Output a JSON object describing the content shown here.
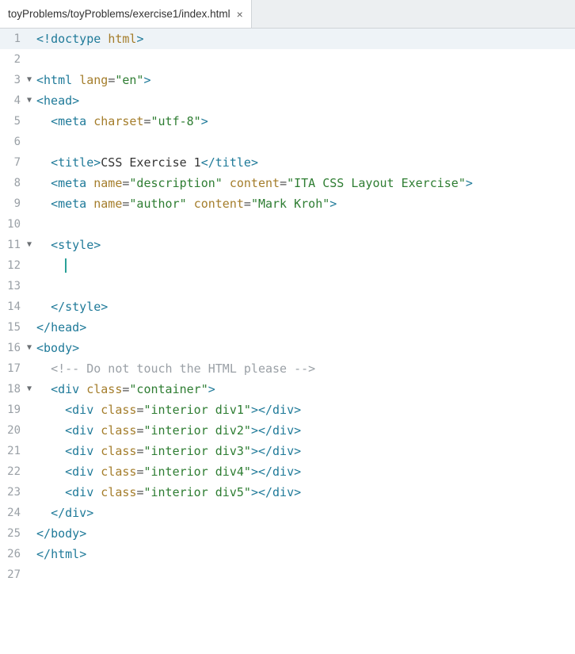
{
  "tab": {
    "title": "toyProblems/toyProblems/exercise1/index.html",
    "close": "×"
  },
  "fold_glyph": "▼",
  "lines": [
    {
      "n": "1",
      "fold": "",
      "active": true,
      "tokens": [
        {
          "c": "t-punc",
          "t": "<!"
        },
        {
          "c": "t-doctype",
          "t": "doctype "
        },
        {
          "c": "t-attr2",
          "t": "html"
        },
        {
          "c": "t-punc",
          "t": ">"
        }
      ]
    },
    {
      "n": "2",
      "fold": "",
      "tokens": []
    },
    {
      "n": "3",
      "fold": "▼",
      "tokens": [
        {
          "c": "t-punc",
          "t": "<"
        },
        {
          "c": "t-tag",
          "t": "html "
        },
        {
          "c": "t-attr2",
          "t": "lang"
        },
        {
          "c": "t-eq",
          "t": "="
        },
        {
          "c": "t-val",
          "t": "\"en\""
        },
        {
          "c": "t-punc",
          "t": ">"
        }
      ]
    },
    {
      "n": "4",
      "fold": "▼",
      "tokens": [
        {
          "c": "t-punc",
          "t": "<"
        },
        {
          "c": "t-tag",
          "t": "head"
        },
        {
          "c": "t-punc",
          "t": ">"
        }
      ]
    },
    {
      "n": "5",
      "fold": "",
      "indent": "  ",
      "tokens": [
        {
          "c": "t-punc",
          "t": "<"
        },
        {
          "c": "t-tag",
          "t": "meta "
        },
        {
          "c": "t-attr2",
          "t": "charset"
        },
        {
          "c": "t-eq",
          "t": "="
        },
        {
          "c": "t-val",
          "t": "\"utf-8\""
        },
        {
          "c": "t-punc",
          "t": ">"
        }
      ]
    },
    {
      "n": "6",
      "fold": "",
      "tokens": []
    },
    {
      "n": "7",
      "fold": "",
      "indent": "  ",
      "tokens": [
        {
          "c": "t-punc",
          "t": "<"
        },
        {
          "c": "t-tag",
          "t": "title"
        },
        {
          "c": "t-punc",
          "t": ">"
        },
        {
          "c": "t-text",
          "t": "CSS Exercise 1"
        },
        {
          "c": "t-punc",
          "t": "</"
        },
        {
          "c": "t-tag",
          "t": "title"
        },
        {
          "c": "t-punc",
          "t": ">"
        }
      ]
    },
    {
      "n": "8",
      "fold": "",
      "indent": "  ",
      "tokens": [
        {
          "c": "t-punc",
          "t": "<"
        },
        {
          "c": "t-tag",
          "t": "meta "
        },
        {
          "c": "t-attr2",
          "t": "name"
        },
        {
          "c": "t-eq",
          "t": "="
        },
        {
          "c": "t-val",
          "t": "\"description\""
        },
        {
          "c": "t-text",
          "t": " "
        },
        {
          "c": "t-attr2",
          "t": "content"
        },
        {
          "c": "t-eq",
          "t": "="
        },
        {
          "c": "t-val",
          "t": "\"ITA CSS Layout Exercise\""
        },
        {
          "c": "t-punc",
          "t": ">"
        }
      ]
    },
    {
      "n": "9",
      "fold": "",
      "indent": "  ",
      "tokens": [
        {
          "c": "t-punc",
          "t": "<"
        },
        {
          "c": "t-tag",
          "t": "meta "
        },
        {
          "c": "t-attr2",
          "t": "name"
        },
        {
          "c": "t-eq",
          "t": "="
        },
        {
          "c": "t-val",
          "t": "\"author\""
        },
        {
          "c": "t-text",
          "t": " "
        },
        {
          "c": "t-attr2",
          "t": "content"
        },
        {
          "c": "t-eq",
          "t": "="
        },
        {
          "c": "t-val",
          "t": "\"Mark Kroh\""
        },
        {
          "c": "t-punc",
          "t": ">"
        }
      ]
    },
    {
      "n": "10",
      "fold": "",
      "tokens": []
    },
    {
      "n": "11",
      "fold": "▼",
      "indent": "  ",
      "tokens": [
        {
          "c": "t-punc",
          "t": "<"
        },
        {
          "c": "t-tag",
          "t": "style"
        },
        {
          "c": "t-punc",
          "t": ">"
        }
      ]
    },
    {
      "n": "12",
      "fold": "",
      "indent": "    ",
      "cursor": true,
      "tokens": []
    },
    {
      "n": "13",
      "fold": "",
      "tokens": []
    },
    {
      "n": "14",
      "fold": "",
      "indent": "  ",
      "tokens": [
        {
          "c": "t-punc",
          "t": "</"
        },
        {
          "c": "t-tag",
          "t": "style"
        },
        {
          "c": "t-punc",
          "t": ">"
        }
      ]
    },
    {
      "n": "15",
      "fold": "",
      "tokens": [
        {
          "c": "t-punc",
          "t": "</"
        },
        {
          "c": "t-tag",
          "t": "head"
        },
        {
          "c": "t-punc",
          "t": ">"
        }
      ]
    },
    {
      "n": "16",
      "fold": "▼",
      "tokens": [
        {
          "c": "t-punc",
          "t": "<"
        },
        {
          "c": "t-tag",
          "t": "body"
        },
        {
          "c": "t-punc",
          "t": ">"
        }
      ]
    },
    {
      "n": "17",
      "fold": "",
      "indent": "  ",
      "tokens": [
        {
          "c": "t-comment",
          "t": "<!-- Do not touch the HTML please -->"
        }
      ]
    },
    {
      "n": "18",
      "fold": "▼",
      "indent": "  ",
      "tokens": [
        {
          "c": "t-punc",
          "t": "<"
        },
        {
          "c": "t-tag",
          "t": "div "
        },
        {
          "c": "t-attr2",
          "t": "class"
        },
        {
          "c": "t-eq",
          "t": "="
        },
        {
          "c": "t-val",
          "t": "\"container\""
        },
        {
          "c": "t-punc",
          "t": ">"
        }
      ]
    },
    {
      "n": "19",
      "fold": "",
      "indent": "    ",
      "tokens": [
        {
          "c": "t-punc",
          "t": "<"
        },
        {
          "c": "t-tag",
          "t": "div "
        },
        {
          "c": "t-attr2",
          "t": "class"
        },
        {
          "c": "t-eq",
          "t": "="
        },
        {
          "c": "t-val",
          "t": "\"interior div1\""
        },
        {
          "c": "t-punc",
          "t": "></"
        },
        {
          "c": "t-tag",
          "t": "div"
        },
        {
          "c": "t-punc",
          "t": ">"
        }
      ]
    },
    {
      "n": "20",
      "fold": "",
      "indent": "    ",
      "tokens": [
        {
          "c": "t-punc",
          "t": "<"
        },
        {
          "c": "t-tag",
          "t": "div "
        },
        {
          "c": "t-attr2",
          "t": "class"
        },
        {
          "c": "t-eq",
          "t": "="
        },
        {
          "c": "t-val",
          "t": "\"interior div2\""
        },
        {
          "c": "t-punc",
          "t": "></"
        },
        {
          "c": "t-tag",
          "t": "div"
        },
        {
          "c": "t-punc",
          "t": ">"
        }
      ]
    },
    {
      "n": "21",
      "fold": "",
      "indent": "    ",
      "tokens": [
        {
          "c": "t-punc",
          "t": "<"
        },
        {
          "c": "t-tag",
          "t": "div "
        },
        {
          "c": "t-attr2",
          "t": "class"
        },
        {
          "c": "t-eq",
          "t": "="
        },
        {
          "c": "t-val",
          "t": "\"interior div3\""
        },
        {
          "c": "t-punc",
          "t": "></"
        },
        {
          "c": "t-tag",
          "t": "div"
        },
        {
          "c": "t-punc",
          "t": ">"
        }
      ]
    },
    {
      "n": "22",
      "fold": "",
      "indent": "    ",
      "tokens": [
        {
          "c": "t-punc",
          "t": "<"
        },
        {
          "c": "t-tag",
          "t": "div "
        },
        {
          "c": "t-attr2",
          "t": "class"
        },
        {
          "c": "t-eq",
          "t": "="
        },
        {
          "c": "t-val",
          "t": "\"interior div4\""
        },
        {
          "c": "t-punc",
          "t": "></"
        },
        {
          "c": "t-tag",
          "t": "div"
        },
        {
          "c": "t-punc",
          "t": ">"
        }
      ]
    },
    {
      "n": "23",
      "fold": "",
      "indent": "    ",
      "tokens": [
        {
          "c": "t-punc",
          "t": "<"
        },
        {
          "c": "t-tag",
          "t": "div "
        },
        {
          "c": "t-attr2",
          "t": "class"
        },
        {
          "c": "t-eq",
          "t": "="
        },
        {
          "c": "t-val",
          "t": "\"interior div5\""
        },
        {
          "c": "t-punc",
          "t": "></"
        },
        {
          "c": "t-tag",
          "t": "div"
        },
        {
          "c": "t-punc",
          "t": ">"
        }
      ]
    },
    {
      "n": "24",
      "fold": "",
      "indent": "  ",
      "tokens": [
        {
          "c": "t-punc",
          "t": "</"
        },
        {
          "c": "t-tag",
          "t": "div"
        },
        {
          "c": "t-punc",
          "t": ">"
        }
      ]
    },
    {
      "n": "25",
      "fold": "",
      "tokens": [
        {
          "c": "t-punc",
          "t": "</"
        },
        {
          "c": "t-tag",
          "t": "body"
        },
        {
          "c": "t-punc",
          "t": ">"
        }
      ]
    },
    {
      "n": "26",
      "fold": "",
      "tokens": [
        {
          "c": "t-punc",
          "t": "</"
        },
        {
          "c": "t-tag",
          "t": "html"
        },
        {
          "c": "t-punc",
          "t": ">"
        }
      ]
    },
    {
      "n": "27",
      "fold": "",
      "tokens": []
    }
  ]
}
